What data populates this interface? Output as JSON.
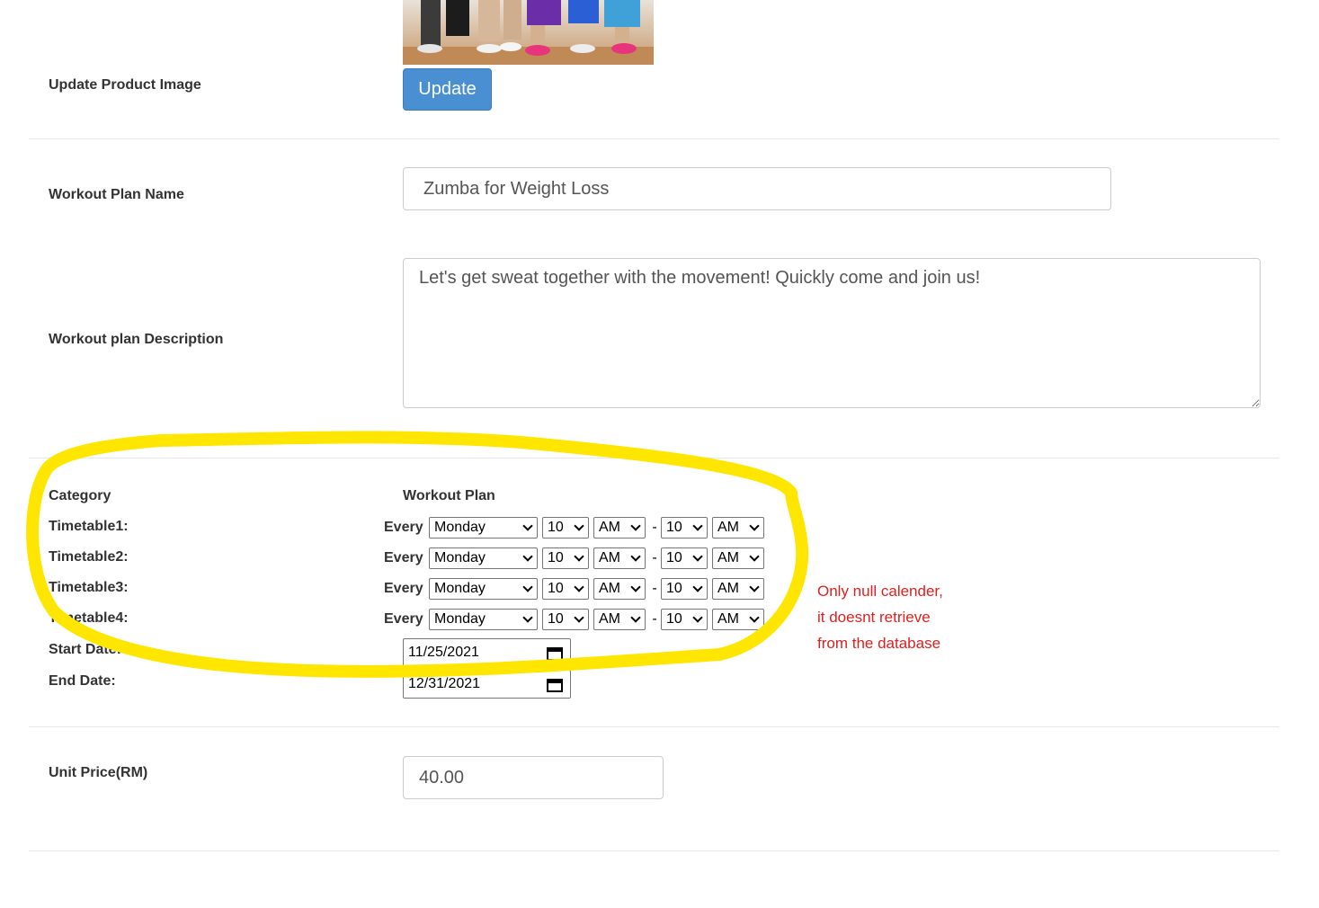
{
  "form": {
    "image_label": "Update Product Image",
    "update_button": "Update",
    "name_label": "Workout Plan Name",
    "name_value": "Zumba for Weight Loss",
    "description_label": "Workout plan Description",
    "description_value": "Let's get sweat together with the movement! Quickly come and join us!",
    "category_label": "Category",
    "category_value": "Workout Plan",
    "timetables": [
      {
        "label": "Timetable1:",
        "every": "Every",
        "day": "Monday",
        "start_hour": "10",
        "start_ampm": "AM",
        "separator": "-",
        "end_hour": "10",
        "end_ampm": "AM"
      },
      {
        "label": "Timetable2:",
        "every": "Every",
        "day": "Monday",
        "start_hour": "10",
        "start_ampm": "AM",
        "separator": "-",
        "end_hour": "10",
        "end_ampm": "AM"
      },
      {
        "label": "Timetable3:",
        "every": "Every",
        "day": "Monday",
        "start_hour": "10",
        "start_ampm": "AM",
        "separator": "-",
        "end_hour": "10",
        "end_ampm": "AM"
      },
      {
        "label": "Timetable4:",
        "every": "Every",
        "day": "Monday",
        "start_hour": "10",
        "start_ampm": "AM",
        "separator": "-",
        "end_hour": "10",
        "end_ampm": "AM"
      }
    ],
    "start_date_label": "Start Date:",
    "start_date_value": "11/25/2021",
    "end_date_label": "End Date:",
    "end_date_value": "12/31/2021",
    "price_label": "Unit Price(RM)",
    "price_value": "40.00"
  },
  "annotation": {
    "lines": [
      "Only null calender,",
      "it doesnt retrieve",
      "from the database"
    ],
    "text_color": "#e02020",
    "highlight_color": "#ffe600"
  },
  "colors": {
    "button_bg": "#4a8fd1",
    "label_text": "#333333",
    "divider": "#e8e8e8"
  },
  "icons": {
    "date_picker": "calendar-icon",
    "select": "chevron-down-icon"
  }
}
